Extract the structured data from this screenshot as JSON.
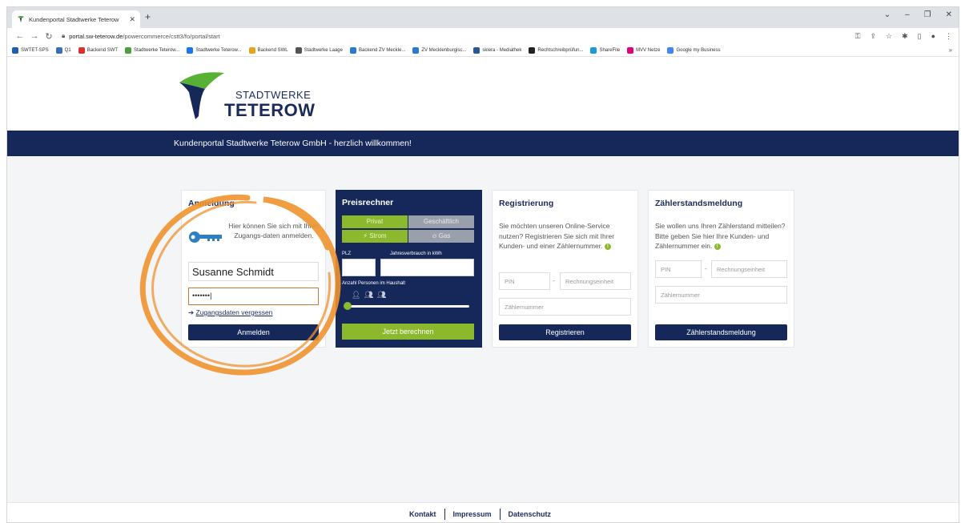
{
  "browser": {
    "tab_title": "Kundenportal Stadtwerke Teterow",
    "url_domain": "portal.sw-teterow.de",
    "url_path": "/powercommerce/cstt3/fo/portal/start",
    "bookmarks": [
      {
        "label": "SWTET-SPS",
        "color": "#1e5fb3"
      },
      {
        "label": "Q1",
        "color": "#3d6fb0"
      },
      {
        "label": "Backend SWT",
        "color": "#d9322b"
      },
      {
        "label": "Stadtwerke Teterow...",
        "color": "#4aa13b"
      },
      {
        "label": "Stadtwerke Teterow...",
        "color": "#1877f2"
      },
      {
        "label": "Backend SWL",
        "color": "#e8a317"
      },
      {
        "label": "Stadtwerke Laage",
        "color": "#555555"
      },
      {
        "label": "Backend ZV Meckle...",
        "color": "#2a7ad5"
      },
      {
        "label": "ZV Mecklenburgisc...",
        "color": "#2a7ad5"
      },
      {
        "label": "sklera - Mediathek",
        "color": "#2b5797"
      },
      {
        "label": "Rechtschreibprüfun...",
        "color": "#222222"
      },
      {
        "label": "ShareFile",
        "color": "#1a9bd7"
      },
      {
        "label": "MVV Netze",
        "color": "#e2007a"
      },
      {
        "label": "Google my Business",
        "color": "#4285f4"
      }
    ]
  },
  "site": {
    "logo_line1": "STADTWERKE",
    "logo_line2": "TETEROW",
    "banner": "Kundenportal Stadtwerke Teterow GmbH - herzlich willkommen!"
  },
  "login": {
    "title": "Anmeldung",
    "description": "Hier können Sie sich mit Ihren Zugangs-daten anmelden.",
    "username": "Susanne Schmidt",
    "password_mask": "•••••••",
    "forgot": "Zugangsdaten vergessen",
    "button": "Anmelden"
  },
  "calculator": {
    "title": "Preisrechner",
    "private": "Privat",
    "business": "Geschäftlich",
    "power": "Strom",
    "gas": "Gas",
    "zip_label": "PLZ",
    "consumption_label": "Jahresverbrauch in kWh",
    "persons_label": "Anzahl Personen im Haushalt",
    "button": "Jetzt berechnen"
  },
  "registration": {
    "title": "Registrierung",
    "description": "Sie möchten unseren Online-Service nutzen? Registrieren Sie sich mit Ihrer Kunden- und einer Zählernummer.",
    "pin_placeholder": "PIN",
    "billing_placeholder": "Rechnungseinheit",
    "meter_placeholder": "Zählernummer",
    "button": "Registrieren"
  },
  "meter_reading": {
    "title": "Zählerstandsmeldung",
    "description": "Sie wollen uns Ihren Zählerstand mitteilen? Bitte geben Sie hier Ihre Kunden- und Zählernummer ein.",
    "pin_placeholder": "PIN",
    "billing_placeholder": "Rechnungseinheit",
    "meter_placeholder": "Zählernummer",
    "button": "Zählerstandsmeldung"
  },
  "footer": {
    "contact": "Kontakt",
    "imprint": "Impressum",
    "privacy": "Datenschutz"
  },
  "colors": {
    "navy": "#16285a",
    "green": "#8cb82d",
    "highlight_circle": "#f0922e"
  }
}
